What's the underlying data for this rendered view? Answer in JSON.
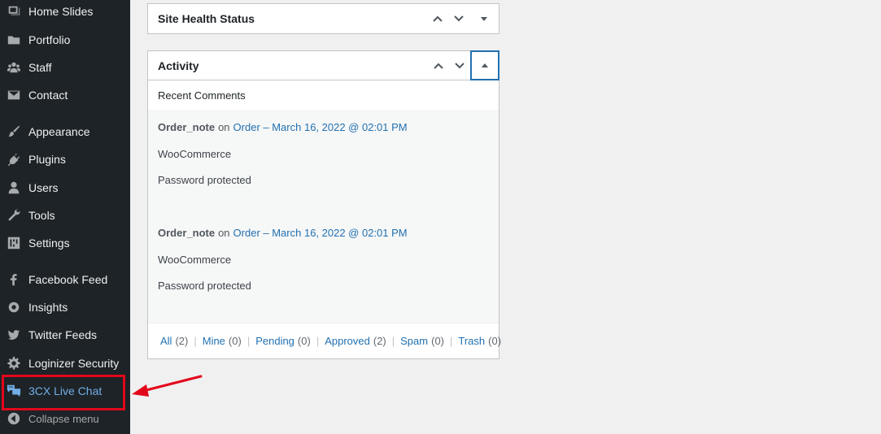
{
  "sidebar": {
    "items": [
      {
        "label": "Home Slides",
        "icon": "home-slides-icon"
      },
      {
        "label": "Portfolio",
        "icon": "folder-icon"
      },
      {
        "label": "Staff",
        "icon": "groups-icon"
      },
      {
        "label": "Contact",
        "icon": "email-icon"
      },
      {
        "label": "Appearance",
        "icon": "paintbrush-icon"
      },
      {
        "label": "Plugins",
        "icon": "plugin-icon"
      },
      {
        "label": "Users",
        "icon": "user-icon"
      },
      {
        "label": "Tools",
        "icon": "wrench-icon"
      },
      {
        "label": "Settings",
        "icon": "settings-icon"
      },
      {
        "label": "Facebook Feed",
        "icon": "facebook-icon"
      },
      {
        "label": "Insights",
        "icon": "insights-icon"
      },
      {
        "label": "Twitter Feeds",
        "icon": "twitter-icon"
      },
      {
        "label": "Loginizer Security",
        "icon": "gear-icon"
      },
      {
        "label": "3CX Live Chat",
        "icon": "chat-bubbles-icon"
      },
      {
        "label": "Collapse menu",
        "icon": "collapse-icon"
      }
    ]
  },
  "site_health": {
    "title": "Site Health Status"
  },
  "activity": {
    "title": "Activity",
    "recent_comments_heading": "Recent Comments",
    "comments": [
      {
        "author": "Order_note",
        "on": "on",
        "link": "Order – March 16, 2022 @ 02:01 PM",
        "line2": "WooCommerce",
        "line3": "Password protected"
      },
      {
        "author": "Order_note",
        "on": "on",
        "link": "Order – March 16, 2022 @ 02:01 PM",
        "line2": "WooCommerce",
        "line3": "Password protected"
      }
    ],
    "filters": [
      {
        "label": "All",
        "count": "(2)"
      },
      {
        "label": "Mine",
        "count": "(0)"
      },
      {
        "label": "Pending",
        "count": "(0)"
      },
      {
        "label": "Approved",
        "count": "(2)"
      },
      {
        "label": "Spam",
        "count": "(0)"
      },
      {
        "label": "Trash",
        "count": "(0)"
      }
    ],
    "separator": "|"
  },
  "colors": {
    "sidebar_bg": "#1d2327",
    "link": "#2271b1",
    "highlight": "#e3071b",
    "chat_accent": "#72aee6"
  }
}
